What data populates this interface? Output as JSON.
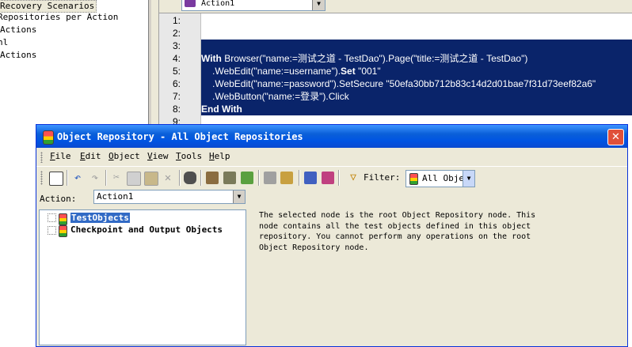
{
  "left_panel": {
    "items": [
      {
        "label": "Recovery Scenarios"
      },
      {
        "label": "Repositories per Action"
      },
      {
        "label": "Actions"
      },
      {
        "label": "nl"
      },
      {
        "label": "Actions"
      }
    ]
  },
  "editor": {
    "action_combo": "Action1",
    "line_numbers": [
      "1:",
      "2:",
      "3:",
      "4:",
      "5:",
      "6:",
      "7:",
      "8:",
      "9:"
    ],
    "code": {
      "line4_kw": "With",
      "line4_rest": " Browser(\"name:=测试之道 - TestDao\").Page(\"title:=测试之道 - TestDao\")",
      "line5_a": ".WebEdit(\"name:=username\").",
      "line5_kw": "Set",
      "line5_b": " \"001\"",
      "line6": ".WebEdit(\"name:=password\").SetSecure \"50efa30bb712b83c14d2d01bae7f31d73eef82a6\"",
      "line7": ".WebButton(\"name:=登录\").Click",
      "line8": "End With"
    }
  },
  "dialog": {
    "title": "Object Repository - All Object Repositories",
    "close_glyph": "✕",
    "menu": [
      {
        "key": "F",
        "rest": "ile"
      },
      {
        "key": "E",
        "rest": "dit"
      },
      {
        "key": "O",
        "rest": "bject"
      },
      {
        "key": "V",
        "rest": "iew"
      },
      {
        "key": "T",
        "rest": "ools"
      },
      {
        "key": "H",
        "rest": "elp"
      }
    ],
    "filter_label": "Filter:",
    "filter_value": "All Obje",
    "action_label": "Action:",
    "action_value": "Action1",
    "tree": {
      "test_objects": "TestObjects",
      "checkpoint_objects": "Checkpoint and Output Objects"
    },
    "info_lines": [
      "The selected node is the root Object Repository node. This",
      "node contains all the test objects defined in this object",
      "repository. You cannot perform any operations on the root",
      "Object Repository node."
    ]
  }
}
